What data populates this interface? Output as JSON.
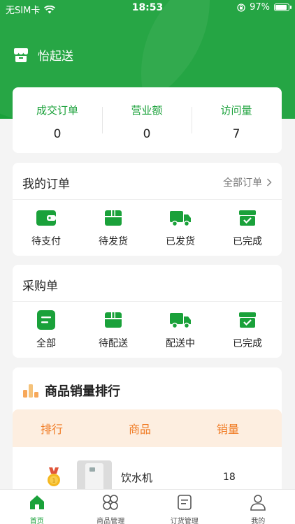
{
  "status_bar": {
    "carrier": "无SIM卡",
    "time": "18:53",
    "battery": "97%"
  },
  "brand": {
    "name": "怡起送"
  },
  "stats": [
    {
      "label": "成交订单",
      "value": "0"
    },
    {
      "label": "营业额",
      "value": "0"
    },
    {
      "label": "访问量",
      "value": "7"
    }
  ],
  "my_orders": {
    "title": "我的订单",
    "all_link": "全部订单",
    "items": [
      {
        "label": "待支付",
        "icon": "wallet-icon"
      },
      {
        "label": "待发货",
        "icon": "package-icon"
      },
      {
        "label": "已发货",
        "icon": "truck-icon"
      },
      {
        "label": "已完成",
        "icon": "box-check-icon"
      }
    ]
  },
  "purchase_orders": {
    "title": "采购单",
    "items": [
      {
        "label": "全部",
        "icon": "list-doc-icon"
      },
      {
        "label": "待配送",
        "icon": "package-icon"
      },
      {
        "label": "配送中",
        "icon": "truck-icon"
      },
      {
        "label": "已完成",
        "icon": "box-check-icon"
      }
    ]
  },
  "ranking": {
    "title": "商品销量排行",
    "columns": [
      "排行",
      "商品",
      "销量"
    ],
    "rows": [
      {
        "rank": "1",
        "product": "饮水机",
        "sales": "18"
      }
    ]
  },
  "tabbar": [
    {
      "label": "首页",
      "icon": "home-icon",
      "active": true
    },
    {
      "label": "商品管理",
      "icon": "grid-icon",
      "active": false
    },
    {
      "label": "订货管理",
      "icon": "document-icon",
      "active": false
    },
    {
      "label": "我的",
      "icon": "user-icon",
      "active": false
    }
  ],
  "colors": {
    "brand_green": "#1aa13a",
    "accent_orange": "#f07a22",
    "header_peach": "#fdeee0"
  }
}
